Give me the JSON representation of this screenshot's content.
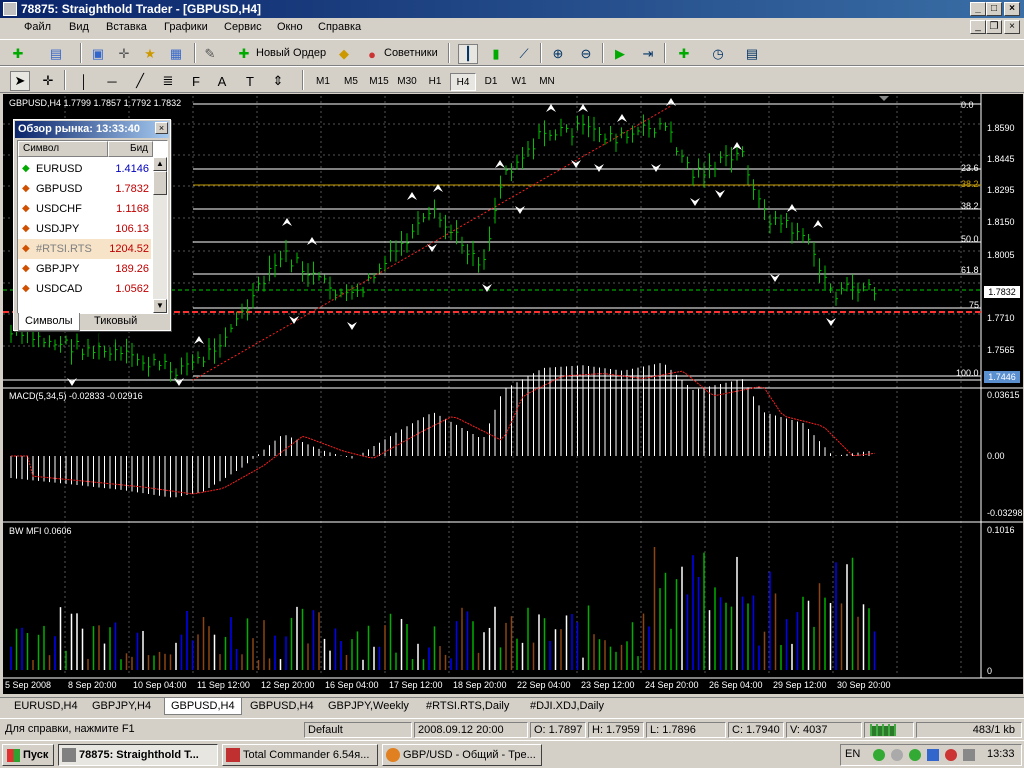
{
  "window": {
    "title": "78875: Straighthold Trader - [GBPUSD,H4]"
  },
  "menu": [
    "Файл",
    "Вид",
    "Вставка",
    "Графики",
    "Сервис",
    "Окно",
    "Справка"
  ],
  "toolbar": {
    "new_order": "Новый Ордер",
    "advisors": "Советники"
  },
  "timeframes": [
    "M1",
    "M5",
    "M15",
    "M30",
    "H1",
    "H4",
    "D1",
    "W1",
    "MN"
  ],
  "active_timeframe": "H4",
  "chart": {
    "info": "GBPUSD,H4  1.7799 1.7857 1.7792 1.7832",
    "price_ticks": [
      "1.8590",
      "1.8445",
      "1.8295",
      "1.8150",
      "1.8005",
      "1.7710",
      "1.7565"
    ],
    "fib_levels": [
      "0.0",
      "23.6",
      "38.2",
      "38.2",
      "50.0",
      "61.8",
      "75",
      "100.0"
    ],
    "current_price": "1.7832",
    "other_price": "1.7446",
    "macd_label": "MACD(5,34,5) -0.02833 -0.02916",
    "macd_ticks": [
      "0.03615",
      "0.00",
      "-0.03298"
    ],
    "bwmfi_label": "BW MFI 0.0606",
    "bwmfi_ticks": [
      "0.1016",
      "0"
    ],
    "time_ticks": [
      "5 Sep 2008",
      "8 Sep 20:00",
      "10 Sep 04:00",
      "11 Sep 12:00",
      "12 Sep 20:00",
      "16 Sep 04:00",
      "17 Sep 12:00",
      "18 Sep 20:00",
      "22 Sep 04:00",
      "23 Sep 12:00",
      "24 Sep 20:00",
      "26 Sep 04:00",
      "29 Sep 12:00",
      "30 Sep 20:00"
    ]
  },
  "market_watch": {
    "title": "Обзор рынка: 13:33:40",
    "col_symbol": "Символ",
    "col_bid": "Бид",
    "rows": [
      {
        "symbol": "EURUSD",
        "bid": "1.4146",
        "dir": "up"
      },
      {
        "symbol": "GBPUSD",
        "bid": "1.7832",
        "dir": "down"
      },
      {
        "symbol": "USDCHF",
        "bid": "1.1168",
        "dir": "down"
      },
      {
        "symbol": "USDJPY",
        "bid": "106.13",
        "dir": "down"
      },
      {
        "symbol": "#RTSI.RTS",
        "bid": "1204.52",
        "dir": "down"
      },
      {
        "symbol": "GBPJPY",
        "bid": "189.26",
        "dir": "down"
      },
      {
        "symbol": "USDCAD",
        "bid": "1.0562",
        "dir": "down"
      }
    ],
    "tabs": [
      "Символы",
      "Тиковый граф"
    ]
  },
  "chart_tabs": [
    "EURUSD,H4",
    "GBPJPY,H4",
    "GBPUSD,H4",
    "GBPUSD,H4",
    "GBPJPY,Weekly",
    "#RTSI.RTS,Daily",
    "#DJI.XDJ,Daily"
  ],
  "active_chart_tab": 2,
  "status": {
    "help": "Для справки, нажмите F1",
    "profile": "Default",
    "datetime": "2008.09.12 20:00",
    "open": "O: 1.7897",
    "high": "H: 1.7959",
    "low": "L: 1.7896",
    "close": "C: 1.7940",
    "volume": "V: 4037",
    "traffic": "483/1 kb"
  },
  "taskbar": {
    "start": "Пуск",
    "tasks": [
      "78875: Straighthold T...",
      "Total Commander 6.54я...",
      "GBP/USD - Общий - Тре..."
    ],
    "lang": "EN",
    "clock": "13:33"
  },
  "colors": {
    "bull": "#00c000",
    "bear": "#00c000",
    "fib": "#ffffff",
    "fib_gold": "#c8a000",
    "trend": "#ff2020",
    "macd_signal": "#ff2020",
    "mfi_green": "#00b000",
    "mfi_blue": "#0000ff",
    "mfi_brown": "#8b4513"
  }
}
